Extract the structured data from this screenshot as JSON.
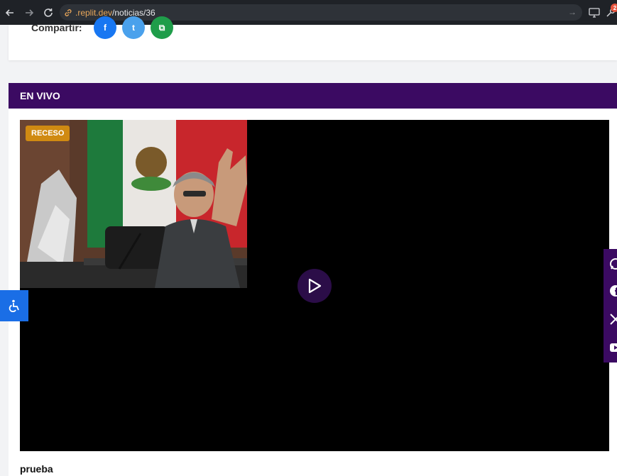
{
  "browser": {
    "url_domain": ".replit.dev",
    "url_path": "/noticias/36",
    "badge_count": "2"
  },
  "share": {
    "label": "Compartir:",
    "facebook_glyph": "f",
    "twitter_glyph": "t",
    "copy_glyph": "⧉"
  },
  "live": {
    "title": "EN VIVO",
    "status_badge": "RECESO",
    "caption": "prueba"
  },
  "colors": {
    "brand_purple": "#3b0a62",
    "badge_orange": "#d08a12",
    "a11y_blue": "#1a6ee6",
    "facebook_blue": "#1877f2",
    "twitter_blue": "#4aa1ec",
    "copy_green": "#1f9d4a"
  },
  "icons": {
    "back": "arrow-left-icon",
    "forward": "arrow-right-icon",
    "reload": "reload-icon",
    "link": "link-icon",
    "play": "play-icon",
    "accessibility": "wheelchair-icon",
    "social": [
      "whatsapp-icon",
      "facebook-icon",
      "x-icon",
      "youtube-icon"
    ]
  }
}
